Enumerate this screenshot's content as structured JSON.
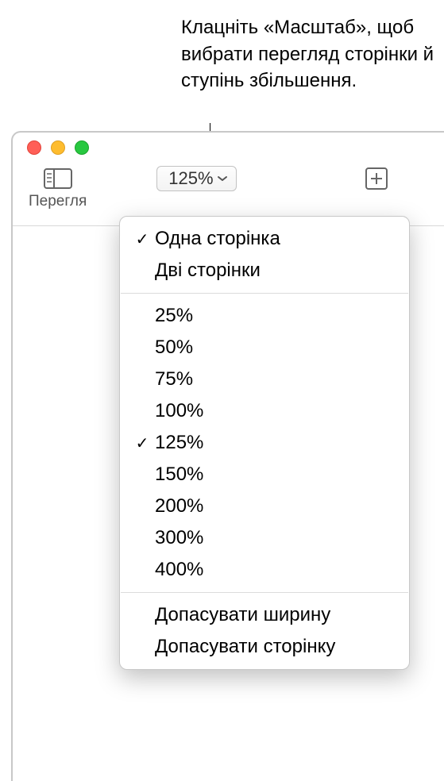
{
  "callout": {
    "text": "Клацніть «Масштаб», щоб вибрати перегляд сторінки й ступінь збільшення."
  },
  "toolbar": {
    "view_label": "Перегля",
    "zoom_value": "125%",
    "zoom_label": ""
  },
  "menu": {
    "page_view": {
      "one_page": "Одна сторінка",
      "two_pages": "Дві сторінки"
    },
    "zoom_levels": {
      "z25": "25%",
      "z50": "50%",
      "z75": "75%",
      "z100": "100%",
      "z125": "125%",
      "z150": "150%",
      "z200": "200%",
      "z300": "300%",
      "z400": "400%"
    },
    "fit": {
      "width": "Допасувати ширину",
      "page": "Допасувати сторінку"
    },
    "selected_page_view": "one_page",
    "selected_zoom": "z125"
  }
}
